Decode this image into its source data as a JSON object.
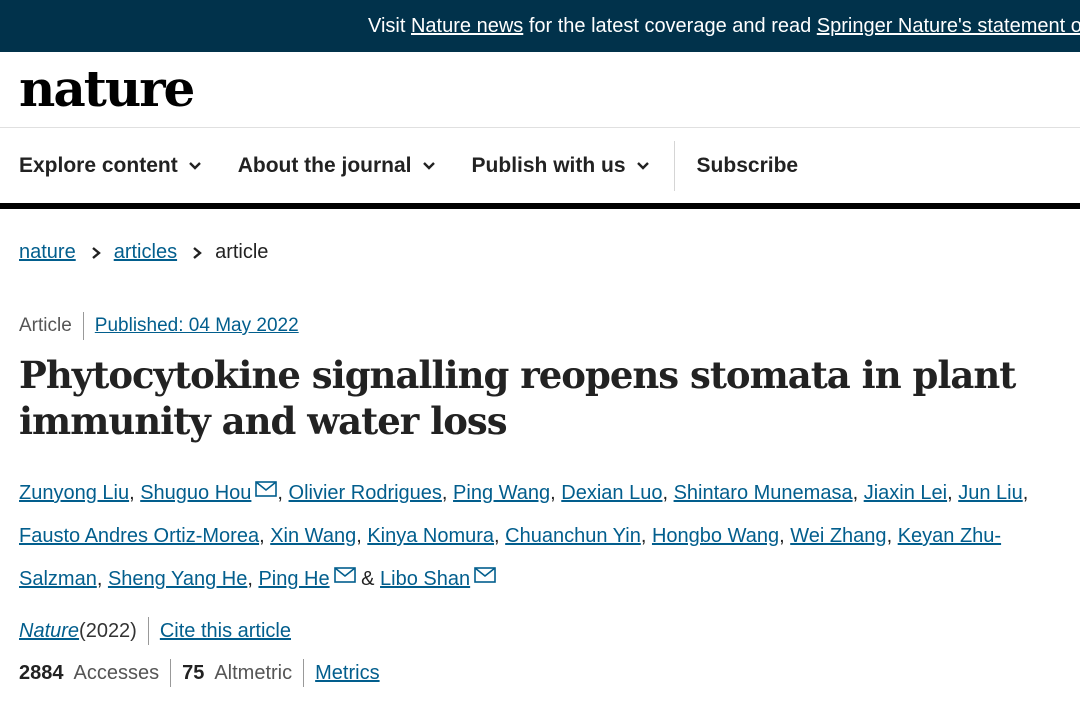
{
  "banner": {
    "prefix": "Visit ",
    "link1": "Nature news",
    "middle": " for the latest coverage and read ",
    "link2": "Springer Nature's statement on the Ukraine conflict"
  },
  "logo": "nature",
  "nav": {
    "items": [
      {
        "label": "Explore content"
      },
      {
        "label": "About the journal"
      },
      {
        "label": "Publish with us"
      }
    ],
    "subscribe": "Subscribe"
  },
  "breadcrumb": {
    "items": [
      "nature",
      "articles",
      "article"
    ]
  },
  "article": {
    "type": "Article",
    "published": "Published: 04 May 2022",
    "title": "Phytocytokine signalling reopens stomata in plant immunity and water loss"
  },
  "authors": [
    {
      "name": "Zunyong Liu",
      "sep": ", "
    },
    {
      "name": "Shuguo Hou",
      "sep": ", ",
      "mail": true
    },
    {
      "name": "Olivier Rodrigues",
      "sep": ", "
    },
    {
      "name": "Ping Wang",
      "sep": ", "
    },
    {
      "name": "Dexian Luo",
      "sep": ", "
    },
    {
      "name": "Shintaro Munemasa",
      "sep": ", "
    },
    {
      "name": "Jiaxin Lei",
      "sep": ", "
    },
    {
      "name": "Jun Liu",
      "sep": ", "
    },
    {
      "name": "Fausto Andres Ortiz-Morea",
      "sep": ", "
    },
    {
      "name": "Xin Wang",
      "sep": ", "
    },
    {
      "name": "Kinya Nomura",
      "sep": ", "
    },
    {
      "name": "Chuanchun Yin",
      "sep": ", "
    },
    {
      "name": "Hongbo Wang",
      "sep": ", "
    },
    {
      "name": "Wei Zhang",
      "sep": ", "
    },
    {
      "name": "Keyan Zhu-Salzman",
      "sep": ", "
    },
    {
      "name": "Sheng Yang He",
      "sep": ", "
    },
    {
      "name": "Ping He",
      "sep": " & ",
      "mail": true
    },
    {
      "name": "Libo Shan",
      "sep": "",
      "mail": true
    }
  ],
  "citation": {
    "journal": "Nature",
    "year": " (2022)",
    "cite_label": "Cite this article"
  },
  "metrics": {
    "accesses_value": "2884",
    "accesses_label": "Accesses",
    "altmetric_value": "75",
    "altmetric_label": "Altmetric",
    "metrics_link": "Metrics"
  },
  "colors": {
    "banner_bg": "#01324b",
    "link": "#025e8d",
    "text": "#222222"
  },
  "icons": [
    "chevron-down-icon",
    "chevron-right-icon",
    "envelope-icon"
  ]
}
